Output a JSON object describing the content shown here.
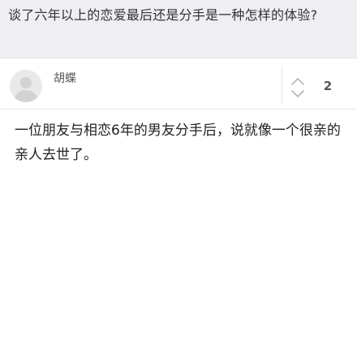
{
  "question": {
    "title": "谈了六年以上的恋爱最后还是分手是一种怎样的体验?"
  },
  "answer": {
    "author": {
      "name": "胡蝶",
      "avatar_icon": "default-avatar-icon"
    },
    "votes": {
      "count": "2",
      "icon": "vote-arrows-icon"
    },
    "content": "一位朋友与相恋6年的男友分手后，说就像一个很亲的亲人去世了。"
  },
  "colors": {
    "header_background": "#eeeef3",
    "text_primary": "#222222",
    "text_secondary": "#555555"
  }
}
